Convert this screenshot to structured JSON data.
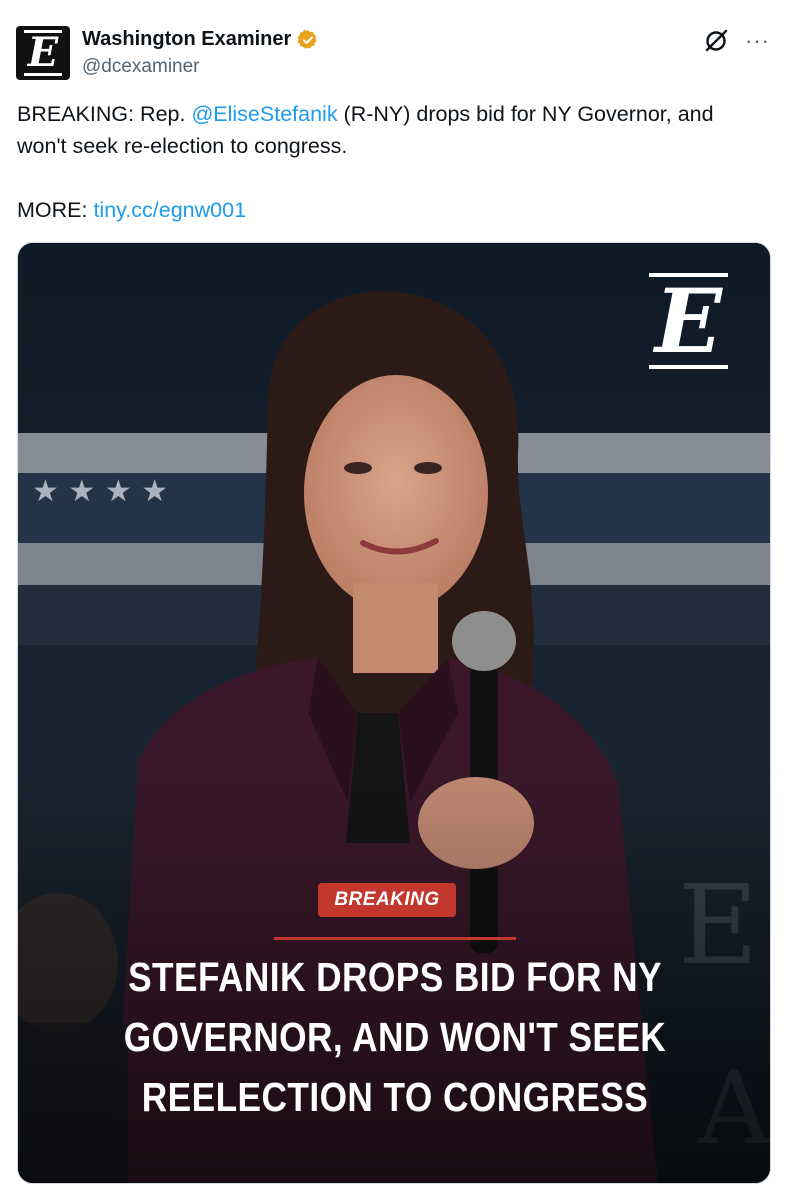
{
  "author": {
    "display_name": "Washington Examiner",
    "handle": "@dcexaminer",
    "avatar_letter": "E",
    "verified_color": "#e8a21b",
    "verified_icon": "verified-badge-icon"
  },
  "header_icons": {
    "grok": "grok-icon",
    "more": "···"
  },
  "tweet": {
    "prefix": "BREAKING: Rep. ",
    "mention": "@EliseStefanik",
    "rest": " (R-NY) drops bid for NY Governor, and won't seek re-election to congress.",
    "more_label": "MORE: ",
    "link": "tiny.cc/egnw001"
  },
  "media": {
    "logo_letter": "E",
    "badge": "BREAKING",
    "headline_lines": [
      "STEFANIK DROPS BID FOR NY",
      "GOVERNOR, AND WON'T SEEK",
      "REELECTION TO CONGRESS"
    ],
    "accent_color": "#c2372e"
  }
}
